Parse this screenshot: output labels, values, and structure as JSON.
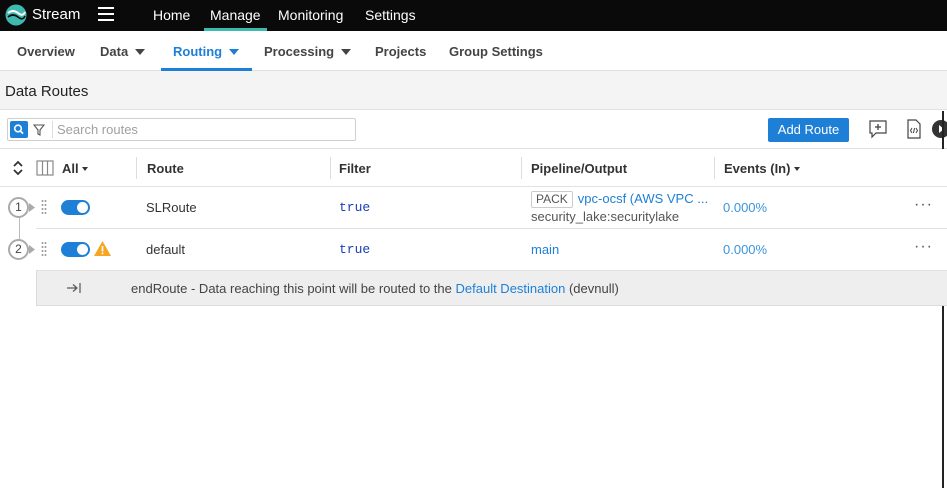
{
  "app": {
    "brand": "Stream",
    "top_nav": [
      "Home",
      "Manage",
      "Monitoring",
      "Settings"
    ],
    "top_nav_active": "Manage"
  },
  "sub_nav": {
    "items": [
      {
        "label": "Overview",
        "has_caret": false
      },
      {
        "label": "Data",
        "has_caret": true
      },
      {
        "label": "Routing",
        "has_caret": true
      },
      {
        "label": "Processing",
        "has_caret": true
      },
      {
        "label": "Projects",
        "has_caret": false
      },
      {
        "label": "Group Settings",
        "has_caret": false
      }
    ],
    "active": "Routing"
  },
  "page": {
    "title": "Data Routes"
  },
  "toolbar": {
    "search_placeholder": "Search routes",
    "add_route_label": "Add Route"
  },
  "table": {
    "select_all_label": "All",
    "columns": [
      "Route",
      "Filter",
      "Pipeline/Output",
      "Events (In)"
    ],
    "rows": [
      {
        "index": "1",
        "enabled": true,
        "warning": false,
        "route": "SLRoute",
        "filter": "true",
        "pack_badge": "PACK",
        "pipeline": "vpc-ocsf (AWS VPC ...",
        "output": "security_lake:securitylake",
        "events": "0.000%"
      },
      {
        "index": "2",
        "enabled": true,
        "warning": true,
        "route": "default",
        "filter": "true",
        "pack_badge": "",
        "pipeline": "main",
        "output": "",
        "events": "0.000%"
      }
    ],
    "end_route": {
      "prefix": "endRoute - Data reaching this point will be routed to the",
      "link": "Default Destination",
      "suffix": "(devnull)"
    }
  },
  "colors": {
    "accent": "#1e7fd6",
    "topbar": "#0a0a0a",
    "warning": "#f5a623"
  }
}
